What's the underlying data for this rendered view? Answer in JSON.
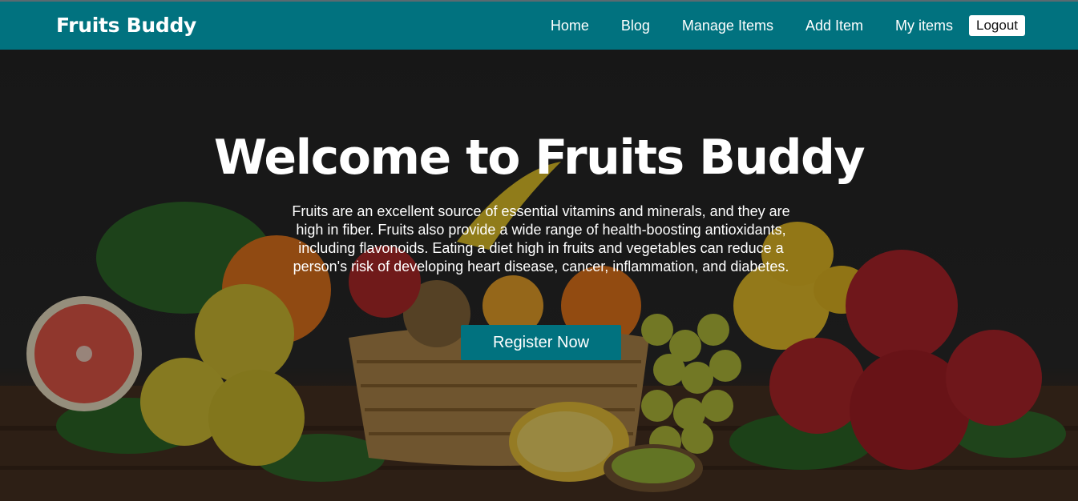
{
  "navbar": {
    "brand": "Fruits Buddy",
    "links": [
      "Home",
      "Blog",
      "Manage Items",
      "Add Item",
      "My items"
    ],
    "logout_label": "Logout",
    "background": "#01727f"
  },
  "hero": {
    "title": "Welcome to Fruits Buddy",
    "description": "Fruits are an excellent source of essential vitamins and minerals, and they are high in fiber. Fruits also provide a wide range of health-boosting antioxidants, including flavonoids. Eating a diet high in fruits and vegetables can reduce a person's risk of developing heart disease, cancer, inflammation, and diabetes.",
    "cta_label": "Register Now",
    "cta_color": "#01727f",
    "background_image": "fruit-basket-photo"
  }
}
